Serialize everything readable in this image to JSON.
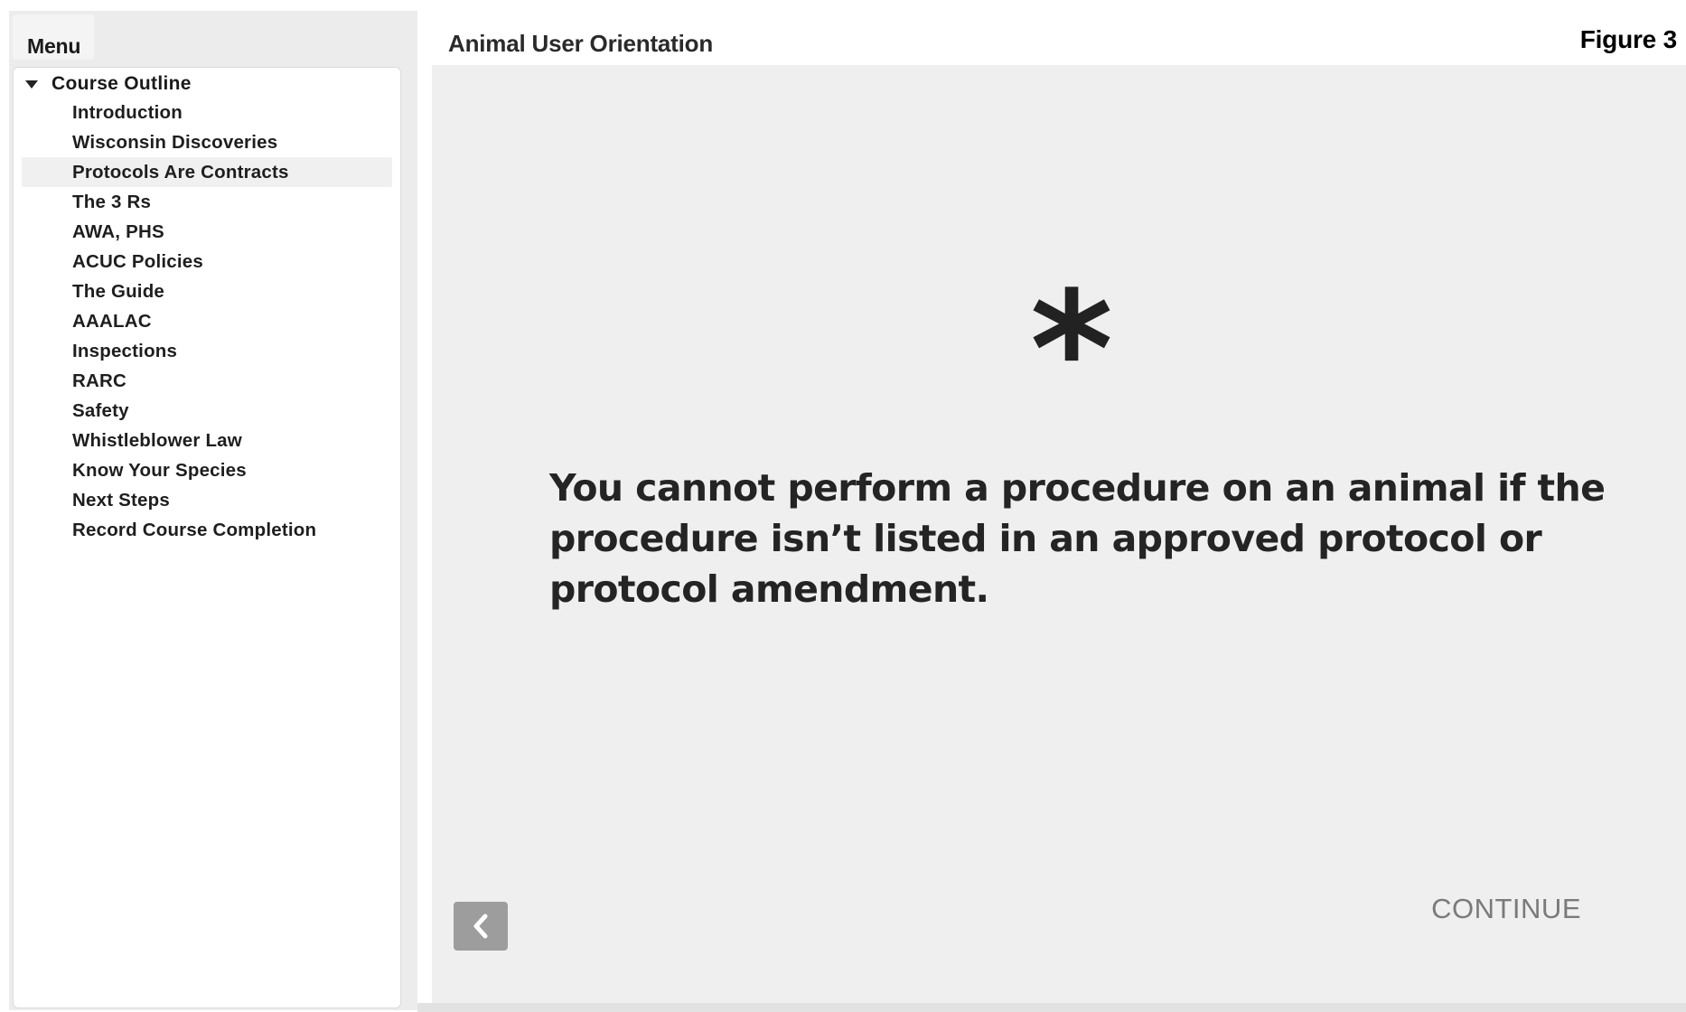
{
  "sidebar": {
    "menu_tab_label": "Menu",
    "outline_label": "Course Outline",
    "items": [
      {
        "label": "Introduction",
        "active": false
      },
      {
        "label": "Wisconsin Discoveries",
        "active": false
      },
      {
        "label": "Protocols Are Contracts",
        "active": true
      },
      {
        "label": "The 3 Rs",
        "active": false
      },
      {
        "label": "AWA, PHS",
        "active": false
      },
      {
        "label": "ACUC Policies",
        "active": false
      },
      {
        "label": "The Guide",
        "active": false
      },
      {
        "label": "AAALAC",
        "active": false
      },
      {
        "label": "Inspections",
        "active": false
      },
      {
        "label": "RARC",
        "active": false
      },
      {
        "label": "Safety",
        "active": false
      },
      {
        "label": "Whistleblower Law",
        "active": false
      },
      {
        "label": "Know Your Species",
        "active": false
      },
      {
        "label": "Next Steps",
        "active": false
      },
      {
        "label": "Record Course Completion",
        "active": false
      }
    ]
  },
  "header": {
    "title": "Animal User Orientation",
    "figure_label": "Figure 3"
  },
  "slide": {
    "symbol": "*",
    "message": "You cannot perform a procedure on an animal if the procedure isn’t listed in an approved protocol or protocol amendment.",
    "back_icon": "chevron-left-icon",
    "continue_label": "CONTINUE"
  },
  "colors": {
    "slide_background": "#efefef",
    "back_button": "#9d9d9d",
    "continue_text": "#7a7a7a",
    "active_item_background": "#f0f0f0"
  }
}
